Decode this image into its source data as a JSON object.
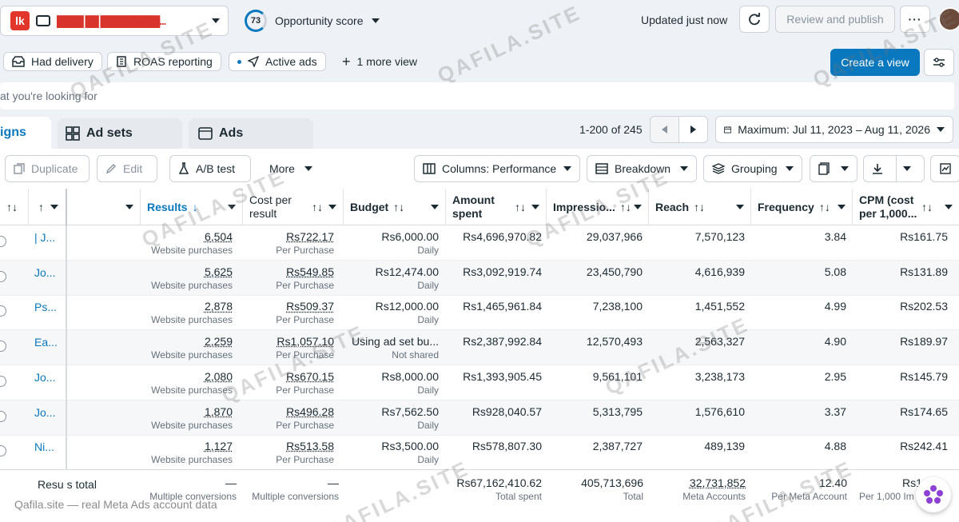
{
  "topbar": {
    "account_name": "████ ██ █████████...",
    "score": "73",
    "score_label": "Opportunity score",
    "updated": "Updated just now",
    "review_publish": "Review and publish"
  },
  "views": {
    "items": [
      "Had delivery",
      "ROAS reporting",
      "Active ads"
    ],
    "more": "1 more view",
    "create": "Create a view"
  },
  "search": {
    "placeholder": "at you're looking for"
  },
  "tabs": [
    "igns",
    "Ad sets",
    "Ads"
  ],
  "pager": {
    "range": "1-200 of 245"
  },
  "date": {
    "label": "Maximum: Jul 11, 2023 – Aug 11, 2026"
  },
  "toolbar": {
    "duplicate": "Duplicate",
    "edit": "Edit",
    "ab_test": "A/B test",
    "more": "More",
    "columns": "Columns: Performance",
    "breakdown": "Breakdown",
    "grouping": "Grouping"
  },
  "columns": {
    "results": "Results",
    "cost_per_result": [
      "Cost per",
      "result"
    ],
    "budget": "Budget",
    "amount_spent": [
      "Amount",
      "spent"
    ],
    "impressions": "Impressio...",
    "reach": "Reach",
    "frequency": "Frequency",
    "cpm": [
      "CPM (cost",
      "per 1,000..."
    ]
  },
  "rows": [
    {
      "name": "| J...",
      "results": "6,504",
      "results_sub": "Website purchases",
      "cpr": "Rs722.17",
      "cpr_sub": "Per Purchase",
      "budget": "Rs6,000.00",
      "budget_sub": "Daily",
      "spent": "Rs4,696,970.82",
      "impressions": "29,037,966",
      "reach": "7,570,123",
      "frequency": "3.84",
      "cpm": "Rs161.75"
    },
    {
      "name": "Jo...",
      "results": "5,625",
      "results_sub": "Website purchases",
      "cpr": "Rs549.85",
      "cpr_sub": "Per Purchase",
      "budget": "Rs12,474.00",
      "budget_sub": "Daily",
      "spent": "Rs3,092,919.74",
      "impressions": "23,450,790",
      "reach": "4,616,939",
      "frequency": "5.08",
      "cpm": "Rs131.89"
    },
    {
      "name": "Ps...",
      "results": "2,878",
      "results_sub": "Website purchases",
      "cpr": "Rs509.37",
      "cpr_sub": "Per Purchase",
      "budget": "Rs12,000.00",
      "budget_sub": "Daily",
      "spent": "Rs1,465,961.84",
      "impressions": "7,238,100",
      "reach": "1,451,552",
      "frequency": "4.99",
      "cpm": "Rs202.53"
    },
    {
      "name": "Ea...",
      "results": "2,259",
      "results_sub": "Website purchases",
      "cpr": "Rs1,057.10",
      "cpr_sub": "Per Purchase",
      "budget": "Using ad set bu...",
      "budget_sub": "Not shared",
      "spent": "Rs2,387,992.84",
      "impressions": "12,570,493",
      "reach": "2,563,327",
      "frequency": "4.90",
      "cpm": "Rs189.97"
    },
    {
      "name": "Jo...",
      "results": "2,080",
      "results_sub": "Website purchases",
      "cpr": "Rs670.15",
      "cpr_sub": "Per Purchase",
      "budget": "Rs8,000.00",
      "budget_sub": "Daily",
      "spent": "Rs1,393,905.45",
      "impressions": "9,561,101",
      "reach": "3,238,173",
      "frequency": "2.95",
      "cpm": "Rs145.79"
    },
    {
      "name": "Jo...",
      "results": "1,870",
      "results_sub": "Website purchases",
      "cpr": "Rs496.28",
      "cpr_sub": "Per Purchase",
      "budget": "Rs7,562.50",
      "budget_sub": "Daily",
      "spent": "Rs928,040.57",
      "impressions": "5,313,795",
      "reach": "1,576,610",
      "frequency": "3.37",
      "cpm": "Rs174.65"
    },
    {
      "name": "Ni...",
      "results": "1,127",
      "results_sub": "Website purchases",
      "cpr": "Rs513.58",
      "cpr_sub": "Per Purchase",
      "budget": "Rs3,500.00",
      "budget_sub": "Daily",
      "spent": "Rs578,807.30",
      "impressions": "2,387,727",
      "reach": "489,139",
      "frequency": "4.88",
      "cpm": "Rs242.41"
    }
  ],
  "totals": {
    "label": "Resu s total",
    "results": "—",
    "results_sub": "Multiple conversions",
    "cpr": "—",
    "cpr_sub": "Multiple conversions",
    "spent": "Rs67,162,410.62",
    "spent_sub": "Total spent",
    "impressions": "405,713,696",
    "impressions_sub": "Total",
    "reach": "32,731,852",
    "reach_sub": "Meta Accounts",
    "frequency": "12.40",
    "frequency_sub": "Per Meta Account",
    "cpm": "Rs1",
    "cpm_sub": "Per 1,000 Im"
  },
  "watermark": {
    "brand": "QAFILA.SITE",
    "caption": "Qafila.site — real Meta Ads account data"
  }
}
